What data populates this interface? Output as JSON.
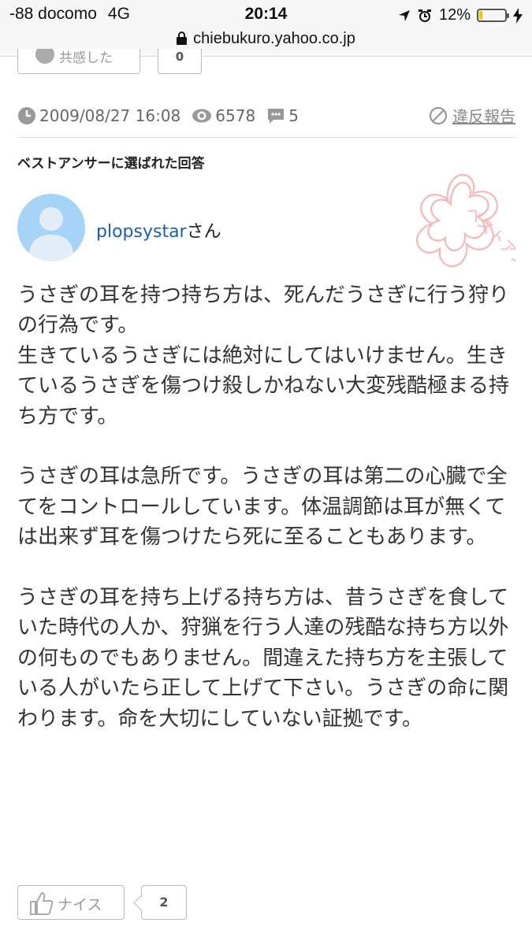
{
  "status_bar": {
    "carrier": "-88 docomo",
    "network": "4G",
    "time": "20:14",
    "battery_percent": "12%",
    "battery_level": 0.12,
    "url": "chiebukuro.yahoo.co.jp"
  },
  "top_reaction": {
    "empathy_label": "共感した",
    "empathy_count": "0"
  },
  "meta": {
    "datetime": "2009/08/27 16:08",
    "views": "6578",
    "comments": "5",
    "report_label": "違反報告"
  },
  "best_answer_label": "ベストアンサーに選ばれた回答",
  "answer": {
    "username": "plopsystar",
    "honorific": "さん",
    "stamp_text": "ベストアンサー",
    "paragraphs": [
      "うさぎの耳を持つ持ち方は、死んだうさぎに行う狩りの行為です。\n生きているうさぎには絶対にしてはいけません。生きているうさぎを傷つけ殺しかねない大変残酷極まる持ち方です。",
      "うさぎの耳は急所です。うさぎの耳は第二の心臓で全てをコントロールしています。体温調節は耳が無くては出来ず耳を傷つけたら死に至ることもあります。",
      "うさぎの耳を持ち上げる持ち方は、昔うさぎを食していた時代の人か、狩猟を行う人達の残酷な持ち方以外の何ものでもありません。間違えた持ち方を主張している人がいたら正して上げて下さい。うさぎの命に関わります。命を大切にしていない証拠です。"
    ]
  },
  "bottom_reaction": {
    "nice_label": "ナイス",
    "nice_count": "2"
  },
  "colors": {
    "link": "#1a5fb4",
    "avatar_bg": "#a6d4f6",
    "stamp": "#f4b8b8",
    "battery": "#f5c200"
  },
  "icons": [
    "lock-icon",
    "location-arrow-icon",
    "alarm-icon",
    "battery-icon",
    "charging-icon",
    "clock-icon",
    "eye-icon",
    "comment-icon",
    "prohibit-icon",
    "thumbs-up-icon",
    "avatar-icon",
    "best-answer-stamp-icon"
  ]
}
